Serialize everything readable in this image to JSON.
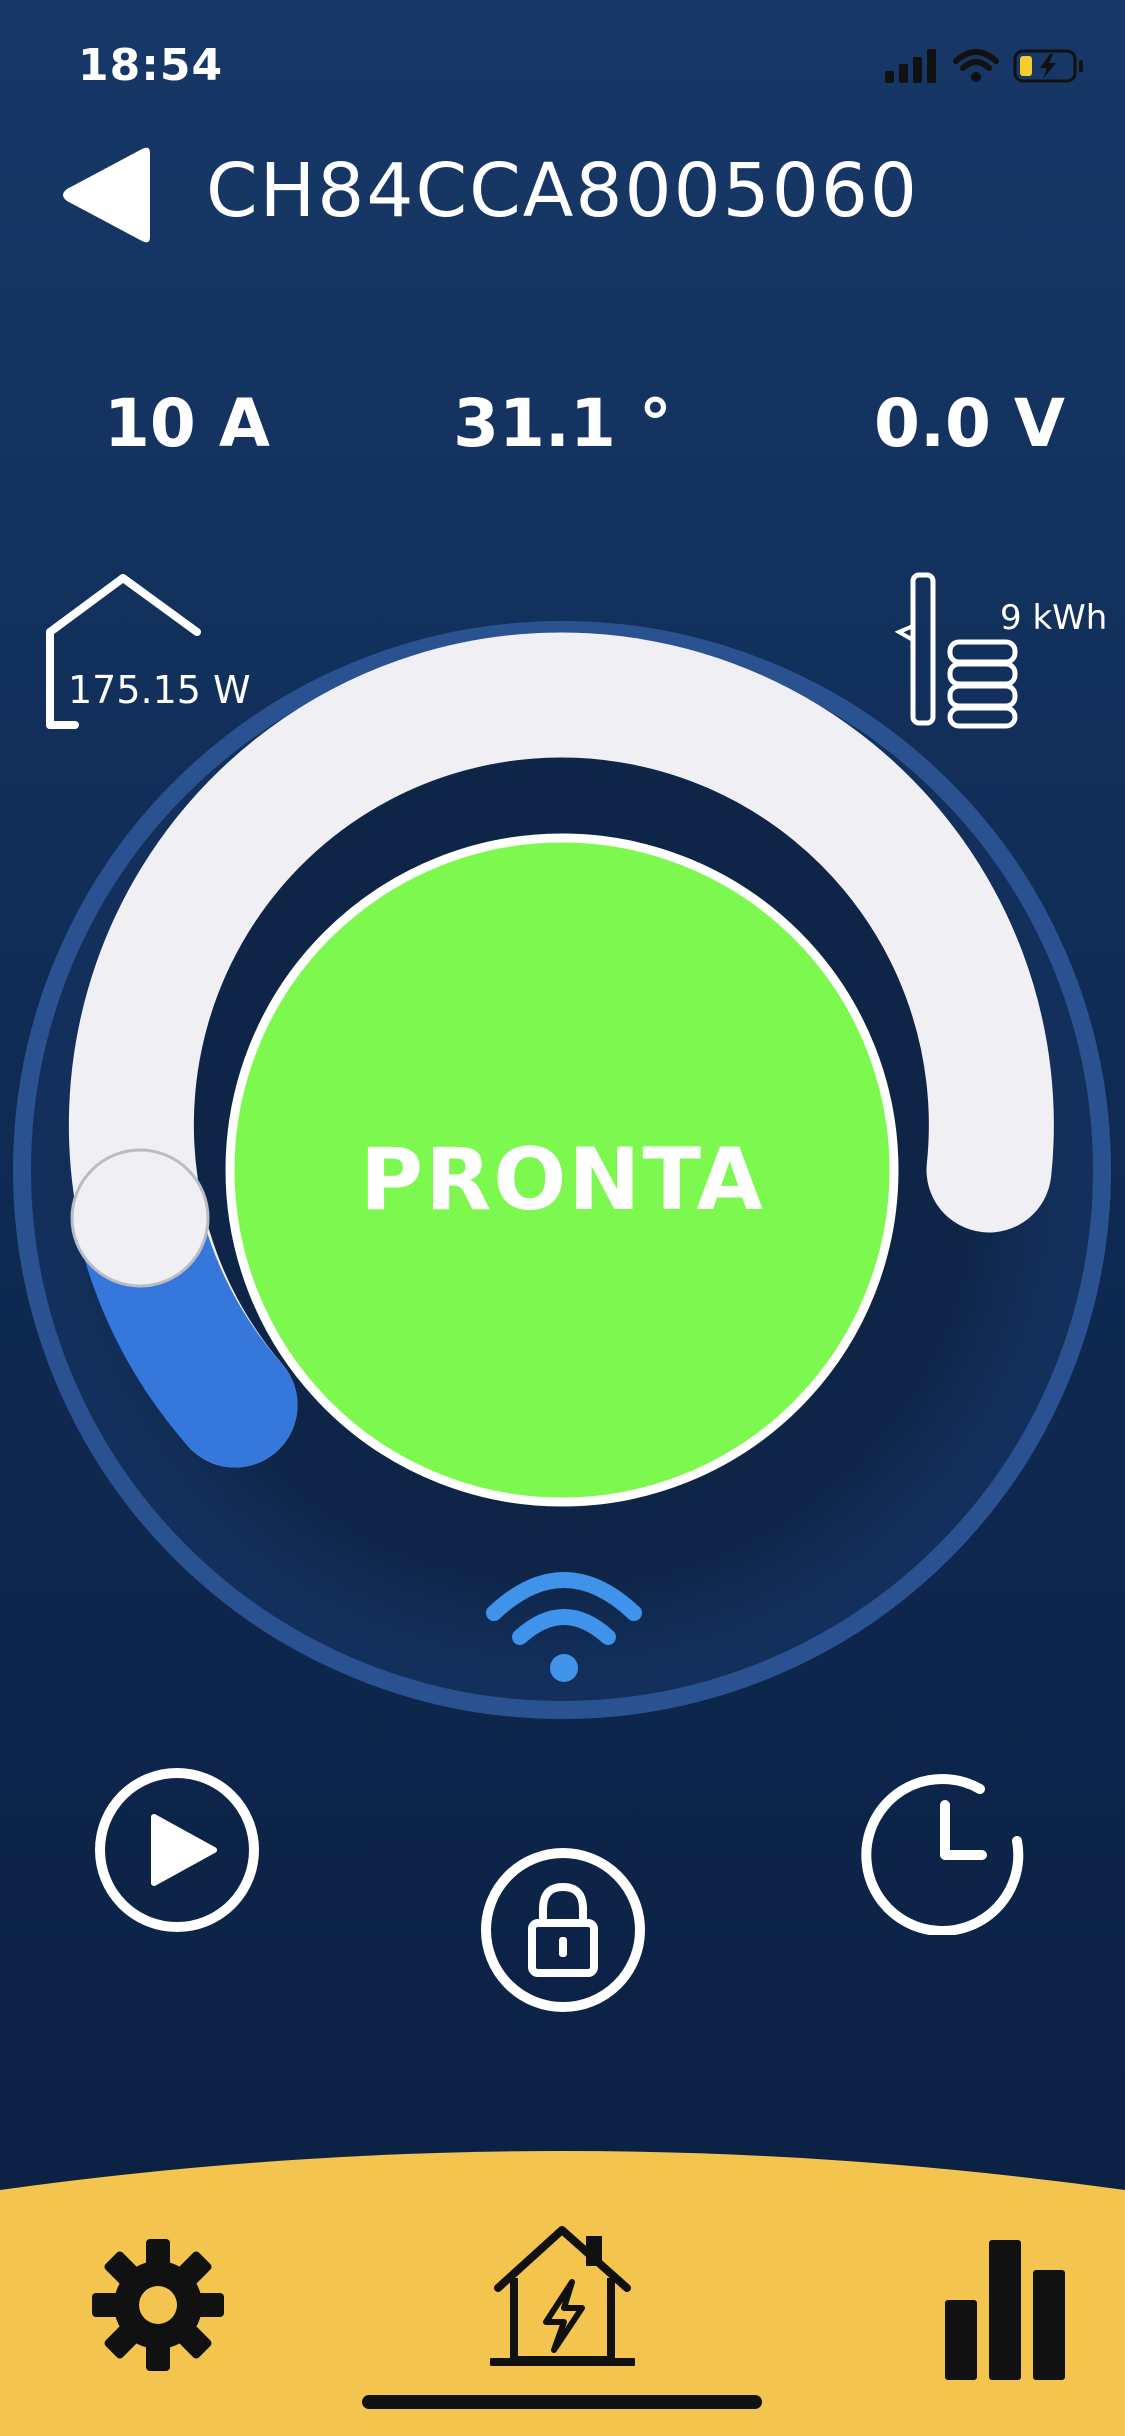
{
  "status_bar": {
    "time": "18:54",
    "icons": [
      "cellular-signal-icon",
      "wifi-icon",
      "battery-charging-icon"
    ]
  },
  "header": {
    "back_icon": "back-triangle-icon",
    "title": "CH84CCA8005060"
  },
  "metrics": {
    "current": "10 A",
    "temperature": "31.1 °",
    "voltage": "0.0 V"
  },
  "house": {
    "icon": "house-icon",
    "power": "175.15 W"
  },
  "battery": {
    "icon": "battery-stack-icon",
    "energy": "9 kWh"
  },
  "dial": {
    "status": "PRONTA",
    "status_color": "#7cf84e",
    "track_color": "#efeff4",
    "active_color": "#3677dc",
    "level_fraction": 0.1,
    "connection_icon": "wifi-icon"
  },
  "actions": {
    "play_icon": "play-icon",
    "lock_icon": "lock-icon",
    "schedule_icon": "clock-icon"
  },
  "bottom_nav": {
    "background": "#f3c54f",
    "items": [
      {
        "icon": "gear-icon"
      },
      {
        "icon": "house-bolt-icon"
      },
      {
        "icon": "bar-chart-icon"
      }
    ]
  }
}
